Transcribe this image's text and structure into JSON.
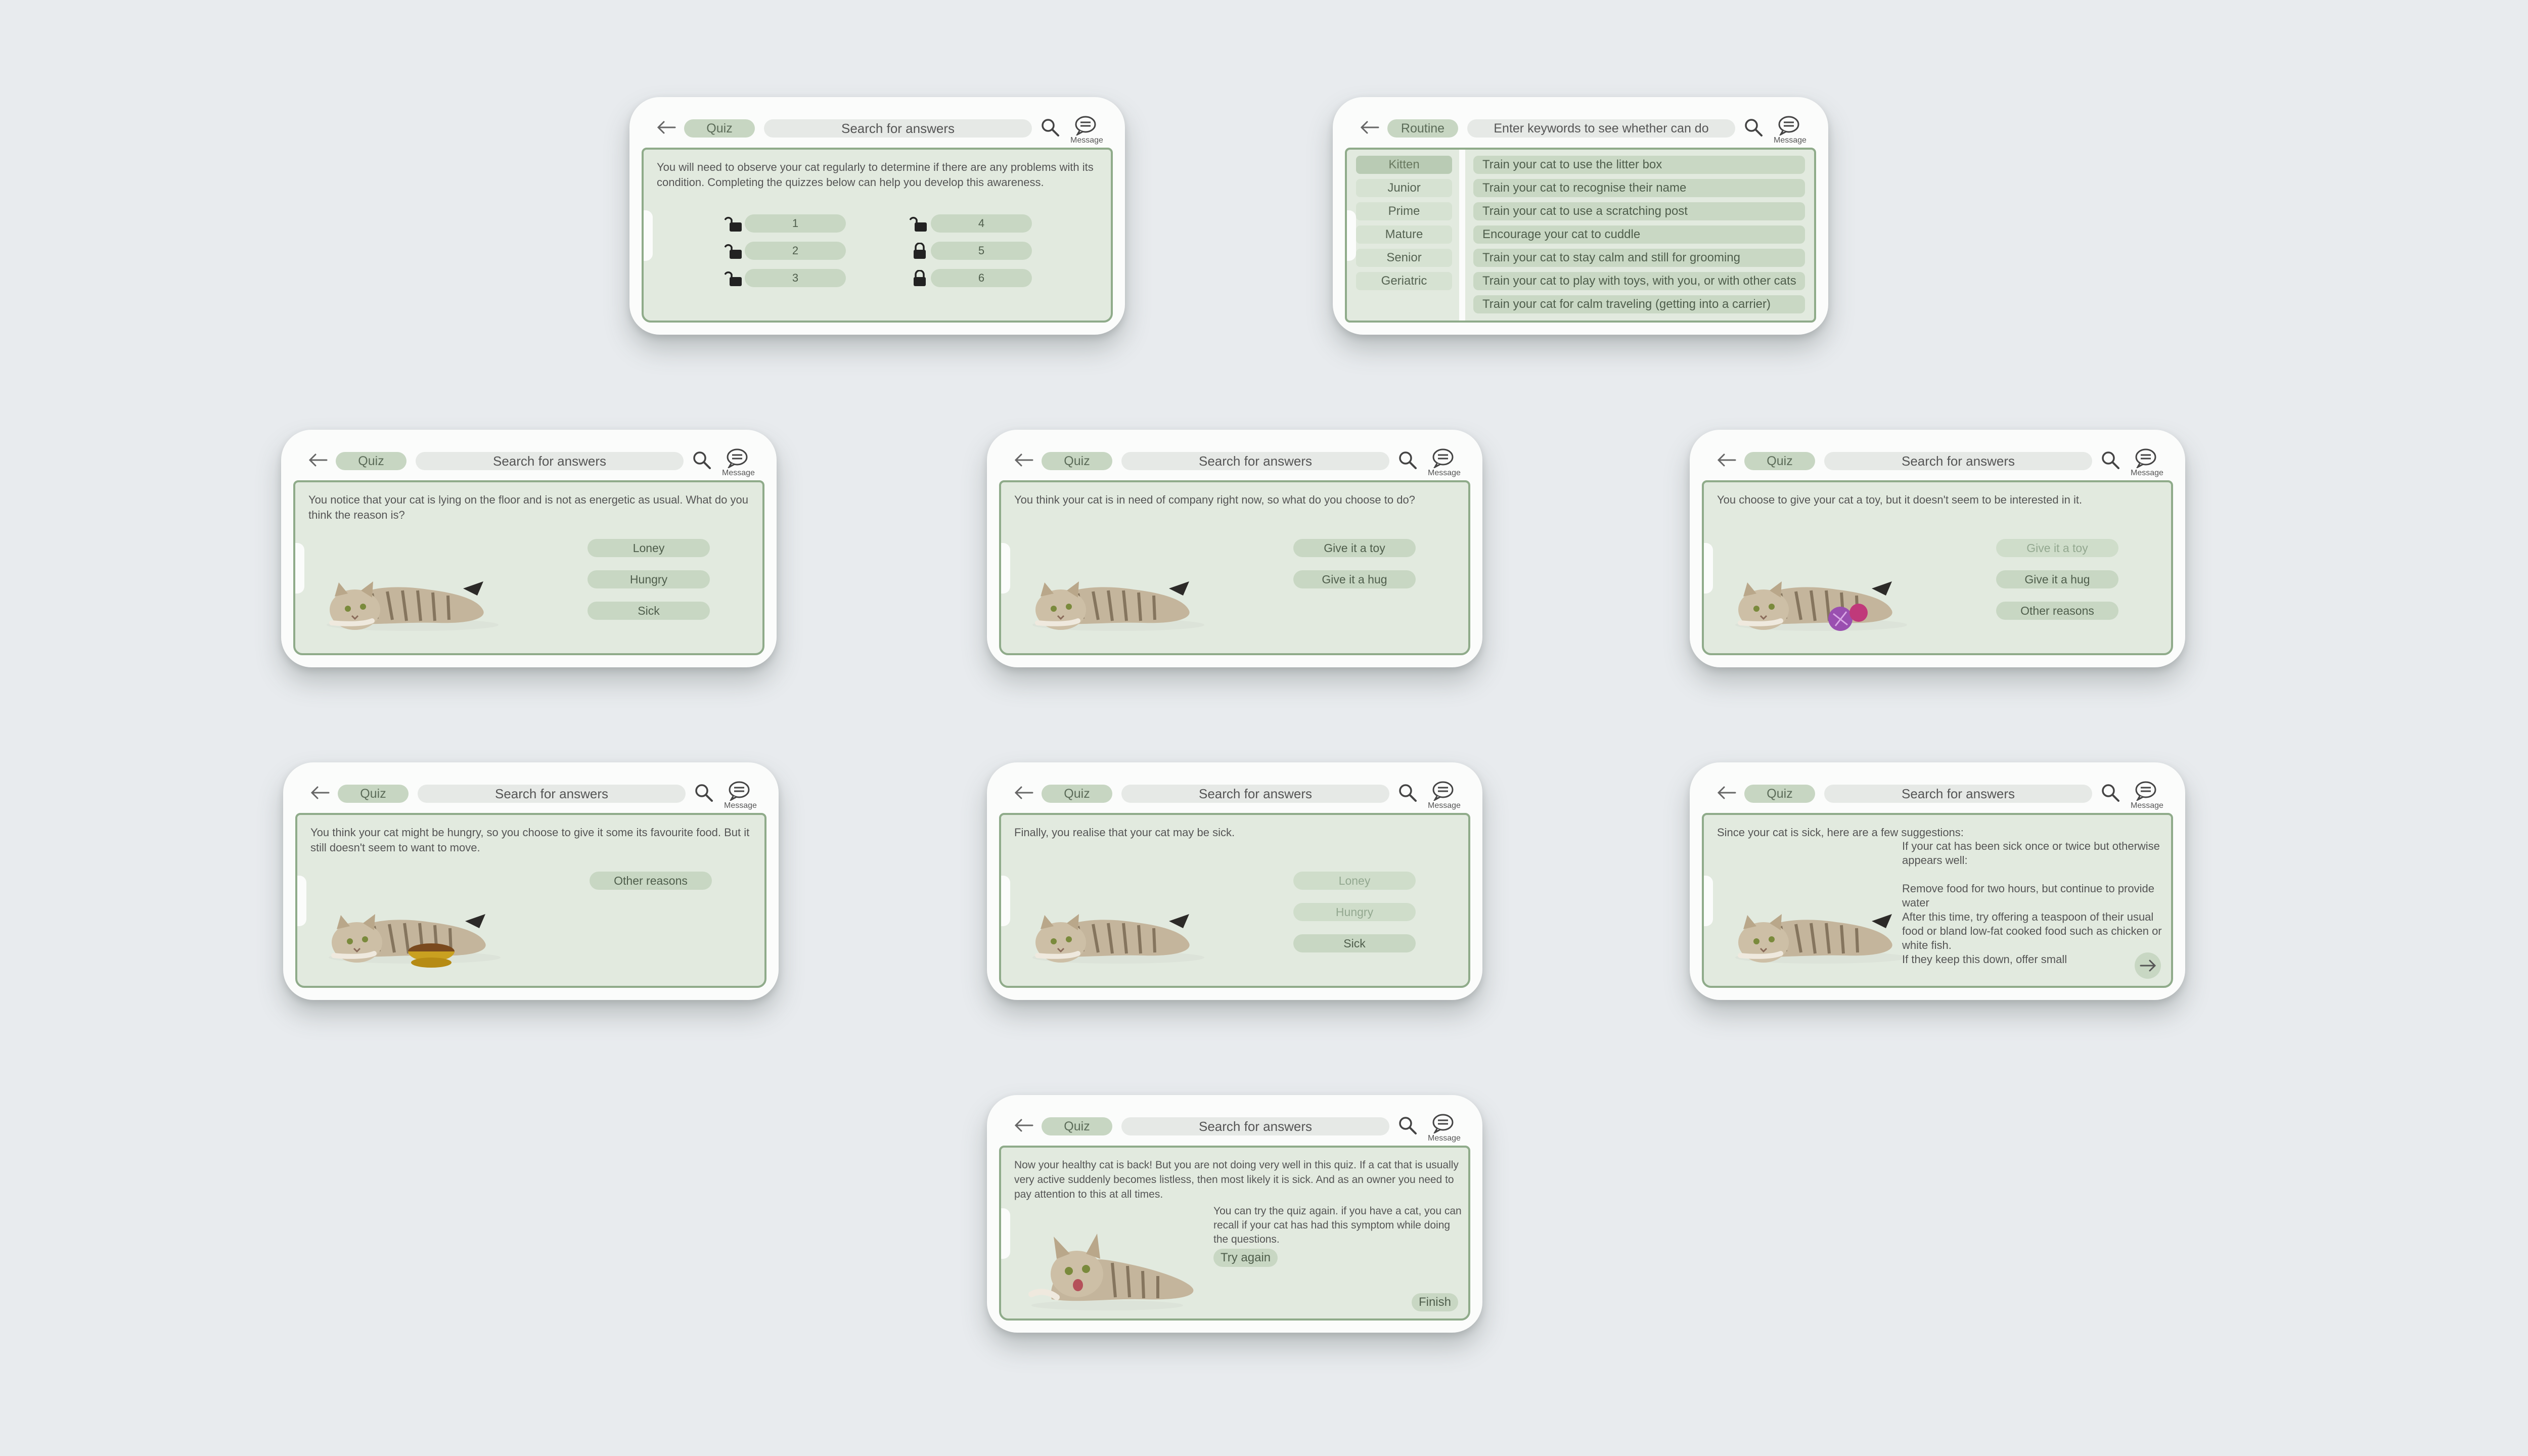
{
  "common": {
    "quiz_chip": "Quiz",
    "search_placeholder": "Search for answers",
    "message_label": "Message"
  },
  "quiz_menu": {
    "intro": "You will need to observe your cat regularly to determine if there are any problems with its condition. Completing the quizzes below can help you develop this awareness.",
    "levels": [
      {
        "label": "1",
        "locked": false
      },
      {
        "label": "2",
        "locked": false
      },
      {
        "label": "3",
        "locked": false
      },
      {
        "label": "4",
        "locked": false
      },
      {
        "label": "5",
        "locked": true
      },
      {
        "label": "6",
        "locked": true
      }
    ]
  },
  "routine": {
    "chip": "Routine",
    "search_placeholder": "Enter keywords to see whether can do",
    "ages": [
      "Kitten",
      "Junior",
      "Prime",
      "Mature",
      "Senior",
      "Geriatric"
    ],
    "selected_age": "Kitten",
    "items": [
      "Train your cat to use the litter box",
      "Train your cat to recognise their name",
      "Train your cat to use a scratching post",
      "Encourage your cat to cuddle",
      "Train your cat to stay calm and still for grooming",
      "Train your cat to play with toys, with you, or with other cats",
      "Train your cat for calm traveling (getting into a carrier)"
    ]
  },
  "q1": {
    "question": "You notice that your cat is lying on the floor and is not as energetic as usual. What do you think the reason is?",
    "options": [
      "Loney",
      "Hungry",
      "Sick"
    ]
  },
  "q2": {
    "question": "You think your cat is in need of company right now, so what do you choose to do?",
    "options": [
      "Give it a toy",
      "Give it a hug"
    ]
  },
  "q3": {
    "question": "You choose to give your cat a toy, but it doesn't seem to be interested in it.",
    "options": [
      "Give it a toy",
      "Give it a hug",
      "Other reasons"
    ]
  },
  "q4": {
    "question": "You think your cat might be hungry, so you choose to give it some its favourite food. But it still doesn't seem to want to move.",
    "options": [
      "Other reasons"
    ]
  },
  "q5": {
    "question": "Finally, you realise that your cat may be sick.",
    "options": [
      "Loney",
      "Hungry",
      "Sick"
    ]
  },
  "q6": {
    "question": "Since your cat is sick, here are a few suggestions:",
    "suggestions": "If your cat has been sick once or twice but otherwise appears well:\n\nRemove food for two hours, but continue to provide water\nAfter this time, try offering a teaspoon of their usual food or bland low-fat cooked food such as chicken or white fish.\nIf they keep this down, offer small"
  },
  "result": {
    "text": "Now your healthy cat is back! But you are not doing very well in this quiz. If a cat that is usually very active suddenly becomes listless, then most likely it is sick. And as an owner you need to pay attention to this at all times.",
    "advice": "You can try the quiz again. if you have a cat, you can recall if your cat has had this symptom while doing the questions.",
    "try_again": "Try again",
    "finish": "Finish"
  }
}
